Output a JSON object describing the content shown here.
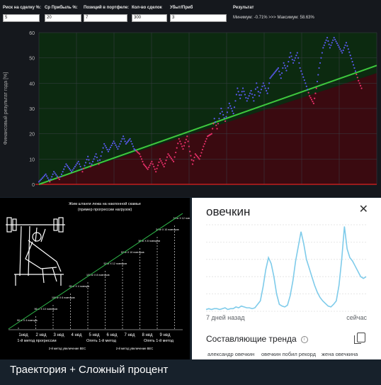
{
  "simulator": {
    "fields": [
      {
        "label": "Риск на сделку %:",
        "value": "5"
      },
      {
        "label": "Ср Прибыль %:",
        "value": "20"
      },
      {
        "label": "Позиций в портфеле:",
        "value": "7"
      },
      {
        "label": "Кол-во сделок",
        "value": "300"
      },
      {
        "label": "Убыт/Приб",
        "value": "3"
      }
    ],
    "result_label": "Результат",
    "result_text": "Минимум: -0.71% >>> Максимум: 58.63%",
    "chart_data": {
      "type": "line",
      "ylabel": "Финансовый результат года [%]",
      "ylim": [
        0,
        60
      ],
      "yticks": [
        "0",
        "10",
        "20",
        "30",
        "40",
        "50",
        "60"
      ],
      "xlim": [
        0,
        300
      ],
      "colors": {
        "up": "#5a5af0",
        "down": "#e8306a",
        "trend": "#3ec83e",
        "zero": "#e02020",
        "above_fill": "#0c2a10",
        "below_fill": "#3a0a10"
      },
      "series": [
        {
          "values": [
            [
              0,
              1
            ],
            [
              10,
              4
            ],
            [
              16,
              1
            ],
            [
              22,
              5
            ],
            [
              30,
              2
            ],
            [
              40,
              8
            ],
            [
              48,
              5
            ],
            [
              58,
              9
            ],
            [
              64,
              5
            ],
            [
              72,
              11
            ],
            [
              76,
              7
            ],
            [
              84,
              12
            ],
            [
              88,
              8
            ],
            [
              96,
              16
            ],
            [
              102,
              13
            ],
            [
              110,
              17
            ],
            [
              116,
              14
            ],
            [
              124,
              19
            ],
            [
              128,
              16
            ],
            [
              134,
              18
            ],
            [
              140,
              14
            ],
            [
              148,
              12
            ],
            [
              154,
              8
            ],
            [
              160,
              6
            ],
            [
              166,
              9
            ],
            [
              172,
              5
            ],
            [
              178,
              10
            ],
            [
              184,
              7
            ],
            [
              190,
              12
            ],
            [
              198,
              9
            ],
            [
              206,
              18
            ],
            [
              212,
              14
            ],
            [
              218,
              19
            ],
            [
              222,
              13
            ],
            [
              226,
              8
            ],
            [
              230,
              12
            ],
            [
              236,
              10
            ],
            [
              242,
              15
            ],
            [
              248,
              19
            ],
            [
              254,
              20
            ],
            [
              258,
              26
            ],
            [
              262,
              22
            ],
            [
              268,
              30
            ],
            [
              274,
              25
            ],
            [
              280,
              32
            ],
            [
              286,
              28
            ],
            [
              292,
              38
            ],
            [
              296,
              34
            ],
            [
              300,
              38
            ],
            [
              306,
              33
            ],
            [
              312,
              37
            ],
            [
              316,
              33
            ],
            [
              320,
              40
            ],
            [
              324,
              35
            ],
            [
              330,
              40
            ],
            [
              336,
              36
            ],
            [
              340,
              42
            ],
            [
              346,
              44
            ],
            [
              352,
              46
            ],
            [
              356,
              42
            ],
            [
              360,
              48
            ],
            [
              364,
              45
            ],
            [
              370,
              52
            ],
            [
              374,
              48
            ],
            [
              380,
              52
            ],
            [
              384,
              46
            ],
            [
              392,
              40
            ],
            [
              398,
              35
            ],
            [
              404,
              32
            ],
            [
              408,
              38
            ],
            [
              412,
              46
            ],
            [
              418,
              54
            ],
            [
              424,
              58
            ],
            [
              428,
              54
            ],
            [
              434,
              58
            ],
            [
              440,
              55
            ],
            [
              446,
              52
            ],
            [
              452,
              56
            ],
            [
              458,
              51
            ],
            [
              464,
              46
            ],
            [
              470,
              41
            ],
            [
              476,
              37
            ]
          ]
        }
      ],
      "trend_line": [
        [
          0,
          0
        ],
        [
          300,
          44
        ]
      ]
    }
  },
  "infographic": {
    "title_line1": "Жим штанги лежа на наклонной скамье",
    "title_line2": "(пример прогрессии нагрузок)",
    "weeks": [
      "1нед",
      "2 нед",
      "3 нед",
      "4 нед",
      "5 нед",
      "6 нед",
      "7 нед",
      "8 нед",
      "9 нед"
    ],
    "steps": [
      "90 кг Х 4 повтора",
      "96 кг Х 10 повторов",
      "106 кг Х 6 повторов",
      "95 кг Х 4 повтора",
      "101 кг Х 8 повторов",
      "52 кг Х 12 повторов",
      "52 кг Х 10 повторов",
      "56 кг Х 8 повторов",
      "34 кг Х 10 повторов",
      "34 кг Х 12 повторов"
    ],
    "methods": [
      "1-й метод прогрессии",
      "2-й метод увеличение ВЕС",
      "Опять 1-й метод",
      "2-й метод увеличение ВЕС",
      "Опять 1-й метод"
    ]
  },
  "trends": {
    "title": "овечкин",
    "close_icon": "close-icon",
    "date_left": "7 дней назад",
    "date_right": "сейчас",
    "section_title": "Составляющие тренда",
    "chips": [
      "александр овечкин",
      "овечкин побил рекорд",
      "жена овечкина"
    ],
    "chart_data": {
      "type": "line",
      "color": "#7ecbea",
      "values": [
        2,
        3,
        2,
        3,
        3,
        2,
        3,
        4,
        2,
        3,
        3,
        5,
        4,
        6,
        5,
        4,
        4,
        3,
        4,
        8,
        12,
        28,
        48,
        62,
        55,
        40,
        20,
        8,
        6,
        5,
        7,
        18,
        35,
        58,
        75,
        92,
        78,
        60,
        50,
        40,
        30,
        22,
        16,
        12,
        9,
        6,
        5,
        8,
        12,
        30,
        60,
        98,
        72,
        62,
        58,
        52,
        46,
        40,
        38,
        40
      ]
    }
  },
  "caption": "Траектория + Сложный процент"
}
